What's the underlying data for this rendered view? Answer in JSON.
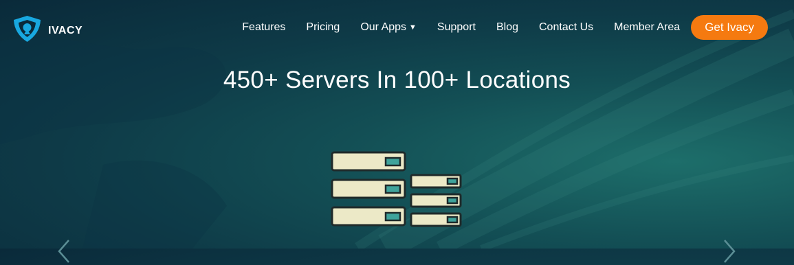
{
  "brand": {
    "name": "IVACY",
    "icon": "shield-logo-icon",
    "color": "#18a8e0"
  },
  "nav": {
    "items": [
      {
        "label": "Features"
      },
      {
        "label": "Pricing"
      },
      {
        "label": "Our Apps",
        "dropdown": true
      },
      {
        "label": "Support"
      },
      {
        "label": "Blog"
      },
      {
        "label": "Contact Us"
      },
      {
        "label": "Member Area"
      }
    ],
    "cta": {
      "label": "Get Ivacy",
      "color": "#f57a10"
    }
  },
  "hero": {
    "title": "450+ Servers In 100+ Locations",
    "illustration": "server-rack-icon",
    "carousel": {
      "prev_icon": "chevron-left-icon",
      "next_icon": "chevron-right-icon"
    }
  }
}
